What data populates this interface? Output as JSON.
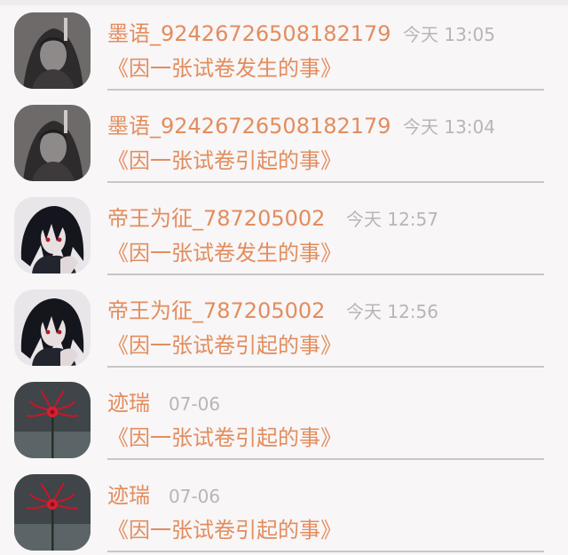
{
  "messages": [
    {
      "user": "墨语_92426726508182179",
      "time": "今天 13:05",
      "title": "《因一张试卷发生的事》",
      "avatar_icon": "gray-anime-girl-avatar"
    },
    {
      "user": "墨语_92426726508182179",
      "time": "今天 13:04",
      "title": "《因一张试卷引起的事》",
      "avatar_icon": "gray-anime-girl-avatar"
    },
    {
      "user": "帝王为征_787205002",
      "time": "今天 12:57",
      "title": "《因一张试卷发生的事》",
      "avatar_icon": "dark-haired-anime-boy-avatar"
    },
    {
      "user": "帝王为征_787205002",
      "time": "今天 12:56",
      "title": "《因一张试卷引起的事》",
      "avatar_icon": "dark-haired-anime-boy-avatar"
    },
    {
      "user": "迹瑞",
      "time": "07-06",
      "title": "《因一张试卷引起的事》",
      "avatar_icon": "red-spider-lily-avatar"
    },
    {
      "user": "迹瑞",
      "time": "07-06",
      "title": "《因一张试卷引起的事》",
      "avatar_icon": "red-spider-lily-avatar"
    }
  ],
  "colors": {
    "accent": "#e28d5e",
    "timestamp": "#b9b5b6",
    "divider": "#c9c6c7",
    "background": "#f8f6f7"
  }
}
